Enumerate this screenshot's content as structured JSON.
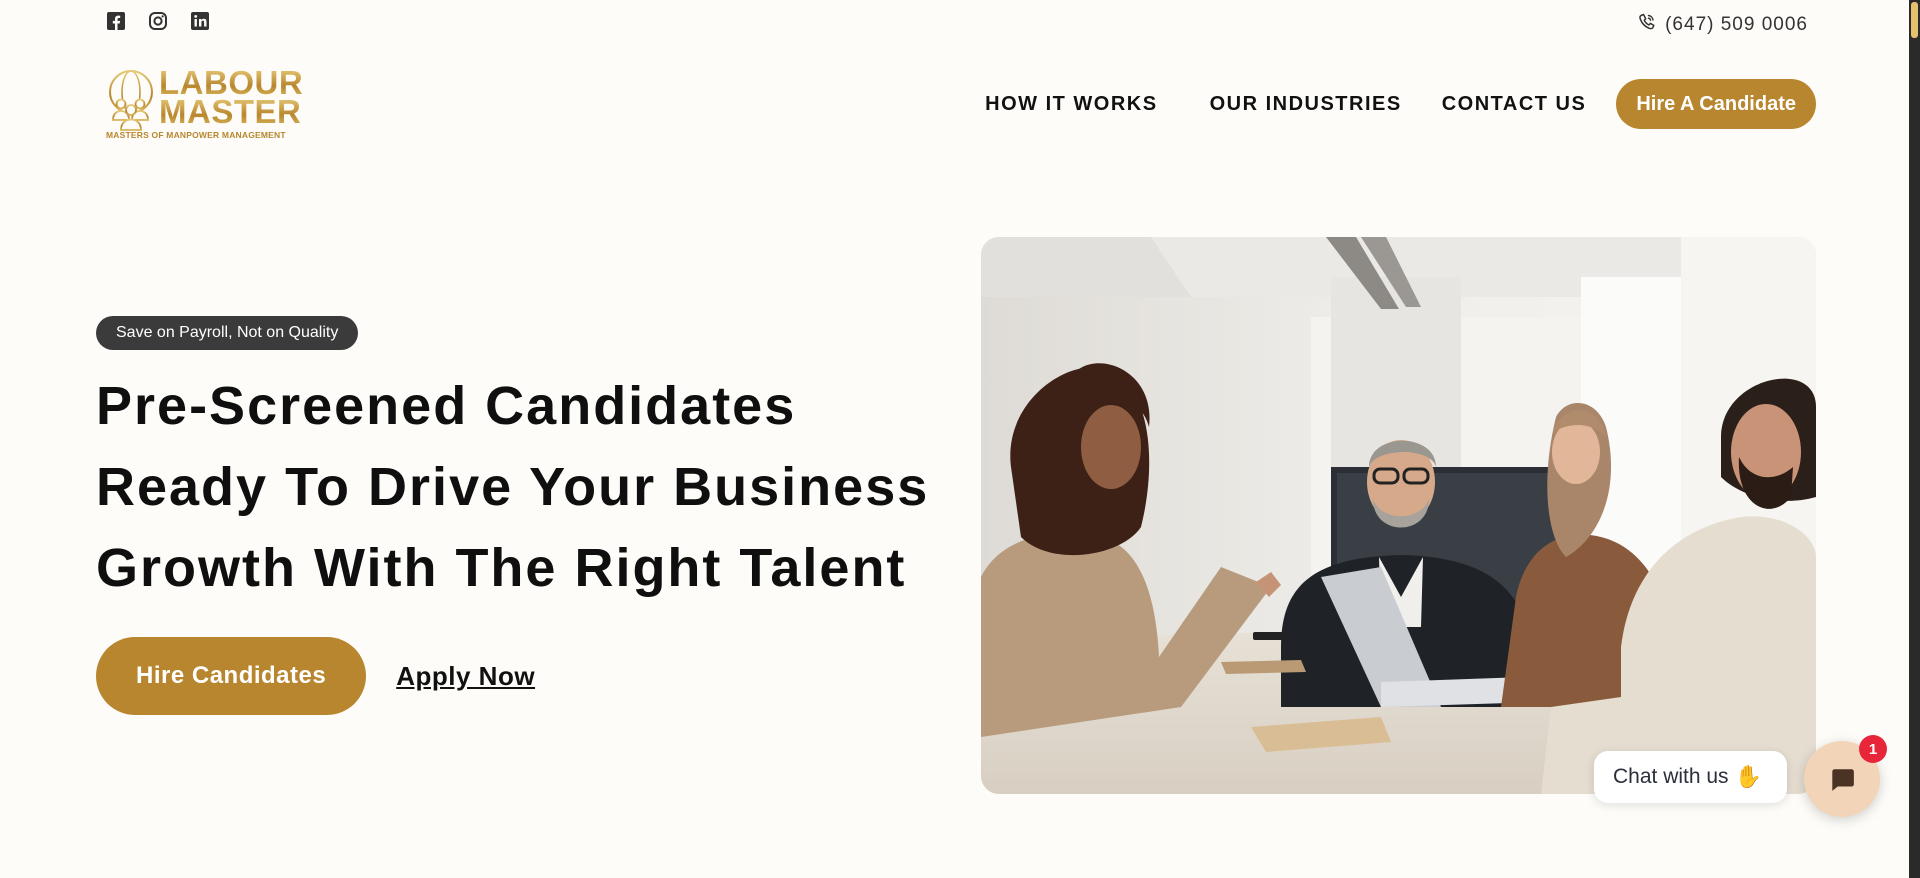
{
  "topbar": {
    "social": [
      {
        "icon": "facebook-icon"
      },
      {
        "icon": "instagram-icon"
      },
      {
        "icon": "linkedin-icon"
      }
    ],
    "phone": "(647) 509 0006"
  },
  "logo": {
    "line1": "LABOUR",
    "line2": "MASTER",
    "tagline": "MASTERS OF MANPOWER MANAGEMENT"
  },
  "nav": {
    "items": [
      "HOW IT WORKS",
      "OUR INDUSTRIES",
      "CONTACT US"
    ],
    "cta": "Hire A Candidate"
  },
  "hero": {
    "badge": "Save on Payroll, Not on Quality",
    "headline": [
      "Pre-Screened Candidates",
      "Ready To Drive Your Business",
      "Growth With The Right Talent"
    ],
    "primary_cta": "Hire Candidates",
    "secondary_cta": "Apply Now",
    "image": "business-handshake-meeting-photo"
  },
  "chat": {
    "prompt": "Chat with us",
    "badge_count": "1"
  },
  "colors": {
    "brand_gold": "#b8862e",
    "background": "#fdfcf8",
    "badge_dark": "#3b3b3b",
    "notification_red": "#e8263a"
  }
}
